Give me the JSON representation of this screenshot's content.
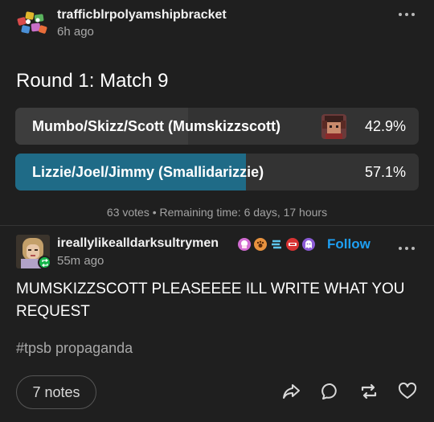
{
  "post": {
    "blog_name": "trafficblrpolyamshipbracket",
    "time": "6h ago",
    "more_icon": "more-dots-icon"
  },
  "poll": {
    "title": "Round 1: Match 9",
    "options": [
      {
        "label": "Mumbo/Skizz/Scott (Mumskizzscott)",
        "percent_text": "42.9%",
        "percent": 42.9,
        "fill_color": "#3d3d3d",
        "selected": false
      },
      {
        "label": "Lizzie/Joel/Jimmy (Smallidarizzie)",
        "percent_text": "57.1%",
        "percent": 57.1,
        "fill_color": "#1f6b87",
        "selected": true
      }
    ],
    "meta": "63 votes • Remaining time: 6 days, 17 hours"
  },
  "reblog": {
    "blog_name": "ireallylikealldarksultrymen",
    "follow_label": "Follow",
    "time": "55m ago",
    "badge_icons": [
      "cupcake-badge-icon",
      "paw-badge-icon",
      "feather-badge-icon",
      "heart-badge-icon",
      "ghost-badge-icon"
    ],
    "body": "MUMSKIZZSCOTT PLEASEEEE ILL WRITE WHAT YOU REQUEST",
    "tag": "#tpsb propaganda",
    "reblog_badge_color": "#15b64a"
  },
  "footer": {
    "notes_label": "7 notes",
    "actions": [
      "share-icon",
      "reply-icon",
      "reblog-icon",
      "like-icon"
    ]
  },
  "colors": {
    "background": "#1f1f1f",
    "accent": "#1e9ff2",
    "poll_selected": "#1f6b87"
  }
}
